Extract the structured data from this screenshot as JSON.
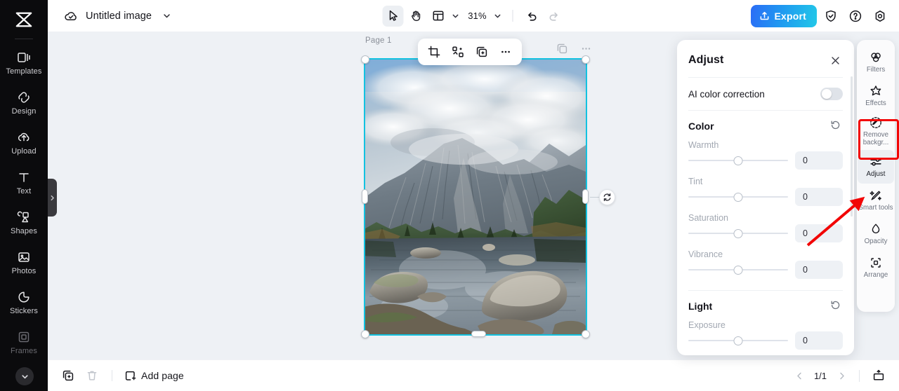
{
  "app": {
    "logo_icon": "capcut-logo-icon"
  },
  "left_rail": {
    "items": [
      {
        "label": "Templates",
        "icon": "templates-icon"
      },
      {
        "label": "Design",
        "icon": "design-icon"
      },
      {
        "label": "Upload",
        "icon": "upload-cloud-icon"
      },
      {
        "label": "Text",
        "icon": "text-icon"
      },
      {
        "label": "Shapes",
        "icon": "shapes-icon"
      },
      {
        "label": "Photos",
        "icon": "photos-icon"
      },
      {
        "label": "Stickers",
        "icon": "stickers-icon"
      },
      {
        "label": "Frames",
        "icon": "frames-icon"
      }
    ],
    "more_icon": "chevron-down-icon",
    "expand_icon": "chevron-right-icon"
  },
  "topbar": {
    "cloud_icon": "cloud-saved-icon",
    "doc_title": "Untitled image",
    "title_chevron_icon": "chevron-down-icon",
    "tools": [
      {
        "name": "select",
        "icon": "cursor-arrow-icon",
        "active": true
      },
      {
        "name": "hand",
        "icon": "hand-icon",
        "active": false
      },
      {
        "name": "layout",
        "icon": "layout-grid-icon",
        "active": false
      }
    ],
    "layout_chevron_icon": "chevron-down-icon",
    "zoom_level": "31%",
    "zoom_chevron_icon": "chevron-down-icon",
    "undo_icon": "undo-icon",
    "redo_icon": "redo-icon",
    "export_label": "Export",
    "export_icon": "export-upload-icon",
    "export_color": "#1f9bf0",
    "right_icons": [
      {
        "name": "shield-check-icon"
      },
      {
        "name": "help-question-icon"
      },
      {
        "name": "settings-gear-icon"
      }
    ]
  },
  "canvas": {
    "page_label": "Page 1",
    "background_color": "#eef1f5",
    "selection_color": "#13c2e0",
    "object_toolbar": [
      {
        "name": "crop",
        "icon": "crop-icon"
      },
      {
        "name": "replace",
        "icon": "replace-media-icon"
      },
      {
        "name": "duplicate",
        "icon": "duplicate-icon"
      },
      {
        "name": "more",
        "icon": "more-horizontal-icon"
      }
    ],
    "extra_tools": [
      {
        "name": "layers",
        "icon": "layers-icon"
      },
      {
        "name": "more",
        "icon": "more-horizontal-icon"
      }
    ],
    "rotate_icon": "rotate-icon"
  },
  "adjust_panel": {
    "title": "Adjust",
    "close_icon": "close-icon",
    "ai_color_correction": {
      "label": "AI color correction",
      "enabled": false
    },
    "sections": [
      {
        "title": "Color",
        "reset_icon": "reset-icon",
        "sliders": [
          {
            "label": "Warmth",
            "value": "0"
          },
          {
            "label": "Tint",
            "value": "0"
          },
          {
            "label": "Saturation",
            "value": "0"
          },
          {
            "label": "Vibrance",
            "value": "0"
          }
        ]
      },
      {
        "title": "Light",
        "reset_icon": "reset-icon",
        "sliders": [
          {
            "label": "Exposure",
            "value": "0"
          }
        ]
      }
    ]
  },
  "right_rail": {
    "items": [
      {
        "label": "Filters",
        "icon": "filters-icon",
        "selected": false
      },
      {
        "label": "Effects",
        "icon": "effects-icon",
        "selected": false
      },
      {
        "label": "Remove backgr...",
        "icon": "remove-background-icon",
        "selected": false
      },
      {
        "label": "Adjust",
        "icon": "adjust-sliders-icon",
        "selected": true
      },
      {
        "label": "Smart tools",
        "icon": "smart-tools-icon",
        "selected": false
      },
      {
        "label": "Opacity",
        "icon": "opacity-icon",
        "selected": false
      },
      {
        "label": "Arrange",
        "icon": "arrange-icon",
        "selected": false
      }
    ],
    "highlight_color": "#f20505"
  },
  "bottombar": {
    "duplicate_icon": "duplicate-page-icon",
    "delete_icon": "trash-icon",
    "add_page_label": "Add page",
    "add_page_icon": "add-page-icon",
    "prev_icon": "chevron-left-icon",
    "next_icon": "chevron-right-icon",
    "page_count": "1/1",
    "present_icon": "present-icon"
  }
}
